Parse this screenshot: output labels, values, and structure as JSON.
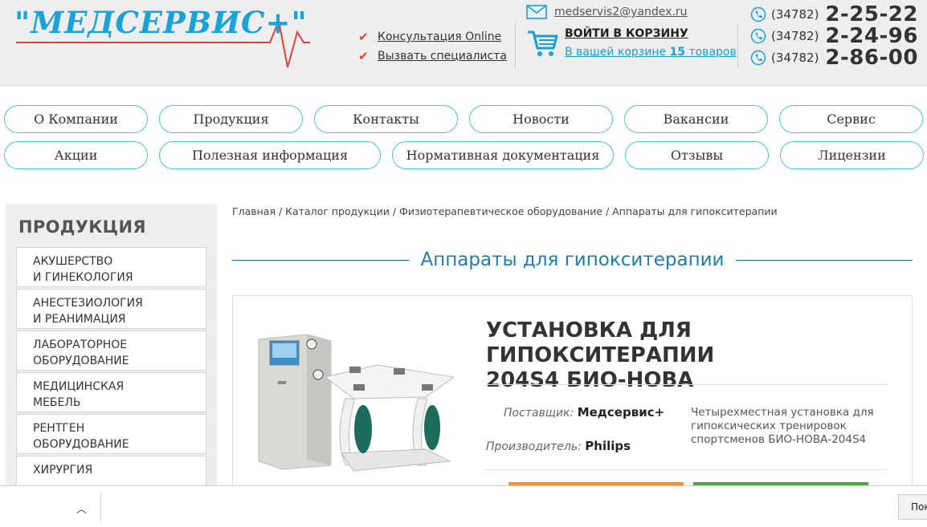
{
  "header": {
    "logo_text": "\"МЕДСЕРВИС+\"",
    "links": [
      "Консультация Online",
      "Вызвать специалиста"
    ],
    "email": "medservis2@yandex.ru",
    "cart_title": "ВОЙТИ В КОРЗИНУ",
    "cart_sub_before": "В вашей корзине ",
    "cart_count": "15",
    "cart_sub_after": " товаров",
    "phones": [
      {
        "code": "(34782)",
        "number": "2-25-22"
      },
      {
        "code": "(34782)",
        "number": "2-24-96"
      },
      {
        "code": "(34782)",
        "number": "2-86-00"
      }
    ]
  },
  "nav": {
    "row1": [
      "О Компании",
      "Продукция",
      "Контакты",
      "Новости",
      "Вакансии",
      "Сервис"
    ],
    "row2": [
      "Акции",
      "Полезная информация",
      "Нормативная документация",
      "Отзывы",
      "Лицензии"
    ]
  },
  "sidebar": {
    "title": "ПРОДУКЦИЯ",
    "items": [
      {
        "line1": "Акушерство",
        "line2": "и гинекология"
      },
      {
        "line1": "Анестезиология",
        "line2": "и реанимация"
      },
      {
        "line1": "Лабораторное",
        "line2": "оборудование"
      },
      {
        "line1": "Медицинская",
        "line2": "мебель"
      },
      {
        "line1": "Рентген",
        "line2": "оборудование"
      },
      {
        "line1": "Хирургия",
        "line2": ""
      }
    ]
  },
  "breadcrumb": "Главная / Каталог продукции / Физиотерапевтическое оборудование / Аппараты для гипокситерапии",
  "page_heading": "Аппараты для гипокситерапии",
  "product": {
    "title_line1": "УСТАНОВКА ДЛЯ ГИПОКСИТЕРАПИИ",
    "title_line2": "204S4 БИО-НОВА",
    "supplier_label": "Поставщик:",
    "supplier": "Медсервис+",
    "maker_label": "Производитель:",
    "maker": "Philips",
    "description": "Четырехместная установка для гипоксических тренировок спортсменов БИО-НОВА-204S4"
  },
  "bottom_bar": {
    "button_label": "Пок"
  },
  "colors": {
    "brand_blue": "#1aa3d9",
    "nav_border": "#4cc6c1",
    "accent_red": "#e2403a",
    "orange": "#f4912c",
    "green": "#49a83a"
  }
}
